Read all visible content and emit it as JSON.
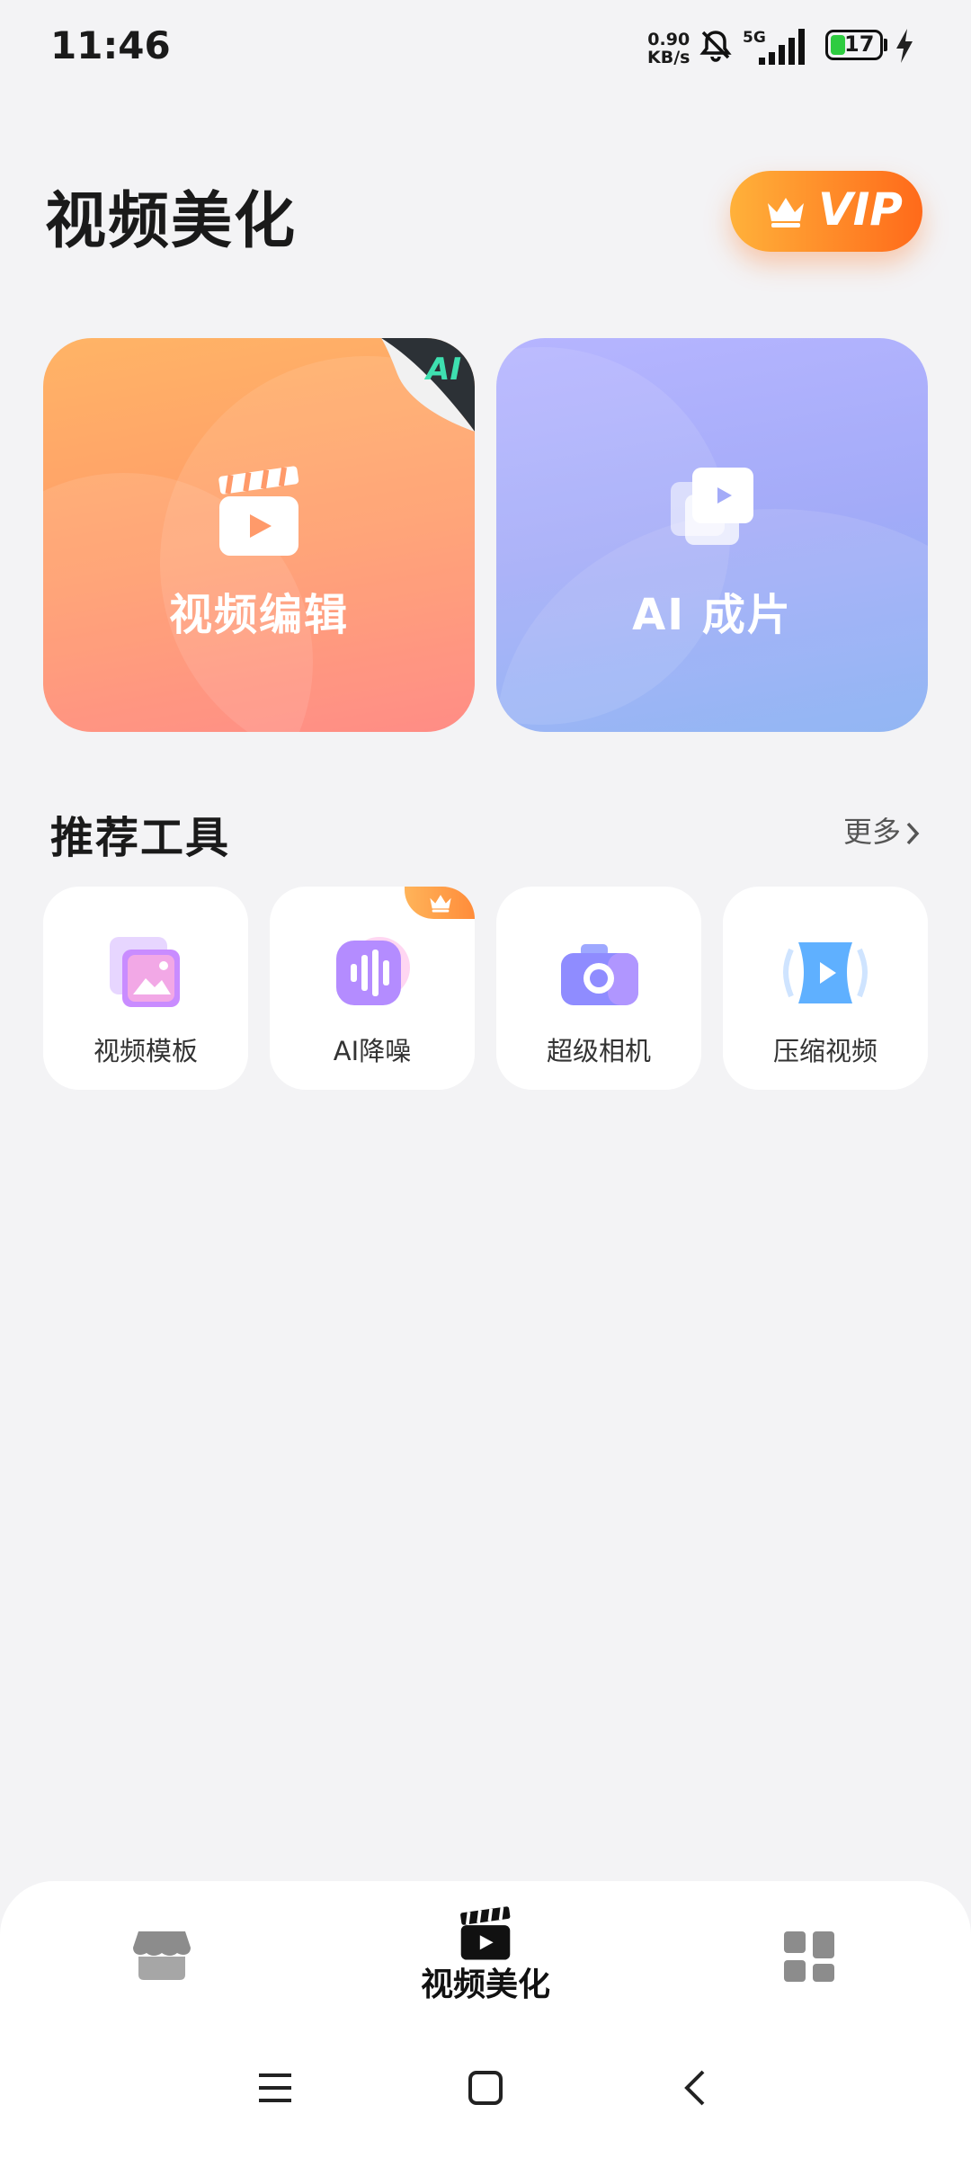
{
  "status_bar": {
    "time": "11:46",
    "speed_value": "0.90",
    "speed_unit": "KB/s",
    "network": "5G",
    "battery": "17"
  },
  "header": {
    "title": "视频美化",
    "vip_label": "VIP"
  },
  "feature_cards": [
    {
      "label": "视频编辑",
      "badge": "AI",
      "icon": "clapperboard-icon"
    },
    {
      "label": "AI 成片",
      "icon": "stacked-play-icon"
    }
  ],
  "tools_section": {
    "title": "推荐工具",
    "more_label": "更多"
  },
  "tools": [
    {
      "label": "视频模板",
      "icon": "template-icon"
    },
    {
      "label": "AI降噪",
      "icon": "noise-reduction-icon",
      "vip": true
    },
    {
      "label": "超级相机",
      "icon": "camera-icon"
    },
    {
      "label": "压缩视频",
      "icon": "compress-video-icon"
    }
  ],
  "bottom_nav": {
    "active_label": "视频美化",
    "items": [
      "store-icon",
      "clapperboard-icon",
      "grid-icon"
    ]
  },
  "colors": {
    "vip_orange": "#ff7a20",
    "edit_card": "#ff9a6a",
    "ai_card": "#a3abf8"
  }
}
